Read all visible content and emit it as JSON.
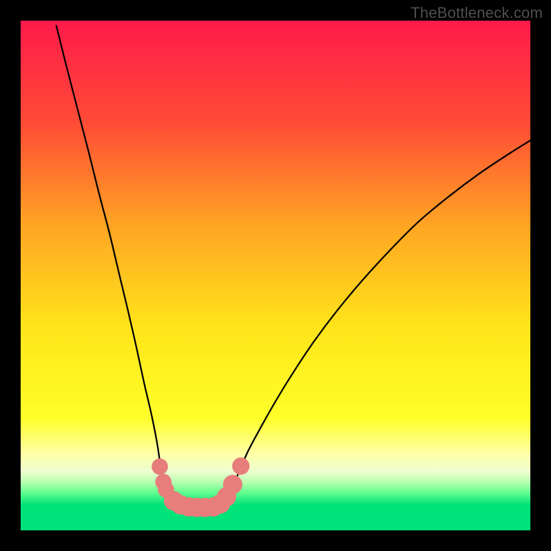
{
  "watermark": "TheBottleneck.com",
  "chart_data": {
    "type": "line",
    "title": "",
    "xlabel": "",
    "ylabel": "",
    "xlim": [
      0,
      100
    ],
    "ylim": [
      0,
      100
    ],
    "background_gradient_stops": [
      {
        "offset": 0.0,
        "color": "#ff1a4b"
      },
      {
        "offset": 0.2,
        "color": "#ff4b36"
      },
      {
        "offset": 0.4,
        "color": "#ffa423"
      },
      {
        "offset": 0.6,
        "color": "#ffe41a"
      },
      {
        "offset": 0.78,
        "color": "#ffff2a"
      },
      {
        "offset": 0.85,
        "color": "#ffffa8"
      },
      {
        "offset": 0.885,
        "color": "#edffd0"
      },
      {
        "offset": 0.905,
        "color": "#b9ffb0"
      },
      {
        "offset": 0.925,
        "color": "#66ff90"
      },
      {
        "offset": 0.95,
        "color": "#00e27a"
      },
      {
        "offset": 1.0,
        "color": "#00e27a"
      }
    ],
    "series": [
      {
        "name": "left-branch",
        "x": [
          7.0,
          9.0,
          11.2,
          13.4,
          15.4,
          17.5,
          19.4,
          21.2,
          22.8,
          24.2,
          25.6,
          26.7,
          27.4,
          27.9,
          28.4,
          29.0,
          30.0,
          31.0,
          32.5,
          34.0,
          35.8,
          37.8
        ],
        "y": [
          99.0,
          91.0,
          82.5,
          74.0,
          66.0,
          58.0,
          50.0,
          42.5,
          35.5,
          29.0,
          23.0,
          17.5,
          13.0,
          10.5,
          8.5,
          7.0,
          6.0,
          5.3,
          4.8,
          4.5,
          4.5,
          4.5
        ]
      },
      {
        "name": "right-branch",
        "x": [
          37.8,
          39.0,
          40.0,
          41.5,
          43.0,
          44.6,
          47.0,
          50.0,
          53.5,
          57.5,
          62.0,
          67.0,
          72.5,
          78.0,
          84.0,
          90.0,
          96.0,
          100.0
        ],
        "y": [
          4.5,
          5.0,
          6.2,
          8.6,
          11.8,
          15.5,
          20.0,
          25.3,
          31.0,
          37.0,
          43.0,
          49.0,
          55.0,
          60.5,
          65.5,
          70.0,
          74.0,
          76.5
        ]
      }
    ],
    "markers": {
      "name": "bottom-dots",
      "color": "#e77e7b",
      "points": [
        {
          "x": 27.3,
          "y": 12.5,
          "r": 1.6
        },
        {
          "x": 28.0,
          "y": 9.5,
          "r": 1.6
        },
        {
          "x": 28.5,
          "y": 8.0,
          "r": 1.6
        },
        {
          "x": 30.0,
          "y": 5.8,
          "r": 1.9
        },
        {
          "x": 31.4,
          "y": 5.0,
          "r": 1.9
        },
        {
          "x": 33.0,
          "y": 4.6,
          "r": 1.9
        },
        {
          "x": 34.6,
          "y": 4.5,
          "r": 1.9
        },
        {
          "x": 36.2,
          "y": 4.5,
          "r": 1.9
        },
        {
          "x": 37.8,
          "y": 4.6,
          "r": 1.9
        },
        {
          "x": 39.2,
          "y": 5.2,
          "r": 1.9
        },
        {
          "x": 40.4,
          "y": 6.6,
          "r": 1.9
        },
        {
          "x": 41.6,
          "y": 9.0,
          "r": 1.9
        },
        {
          "x": 43.2,
          "y": 12.6,
          "r": 1.7
        }
      ]
    }
  }
}
